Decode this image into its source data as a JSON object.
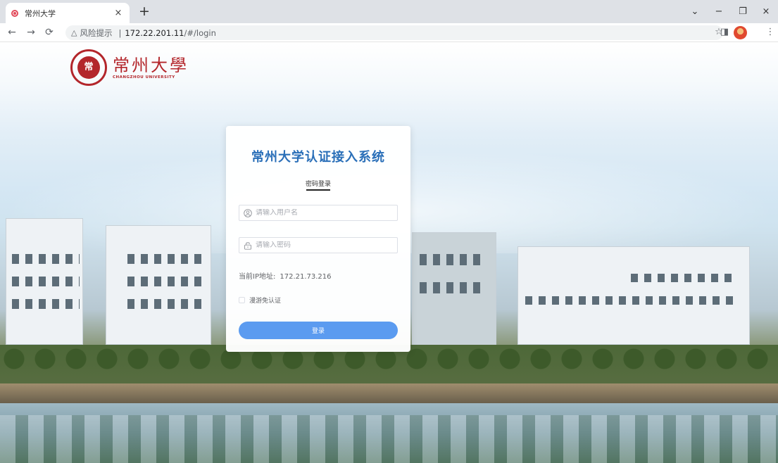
{
  "browser": {
    "tab_title": "常州大学",
    "tab_close": "×",
    "new_tab": "+",
    "window_controls": {
      "tabsearch": "⌄",
      "minimize": "−",
      "maximize": "❐",
      "close": "×"
    },
    "address": {
      "warning_icon": "△",
      "risk_label": "风险提示",
      "separator": "|",
      "host": "172.22.201.11",
      "path": "/#/login"
    },
    "nav": {
      "back": "←",
      "forward": "→",
      "reload": "⟳"
    },
    "toolbar": {
      "star": "☆",
      "sidebar": "◨",
      "menu": "⋮"
    }
  },
  "logo": {
    "seal_char": "常",
    "name_cn": "常州大學",
    "name_en": "CHANGZHOU UNIVERSITY"
  },
  "login": {
    "title": "常州大学认证接入系统",
    "tab_label": "密码登录",
    "username_placeholder": "请输入用户名",
    "password_placeholder": "请输入密码",
    "ip_label": "当前IP地址:",
    "ip_value": "172.21.73.216",
    "roam_label": "漫游免认证",
    "roam_checked": false,
    "submit_label": "登录",
    "accent_color": "#2a6fb8",
    "button_color": "#5b9bf0"
  }
}
